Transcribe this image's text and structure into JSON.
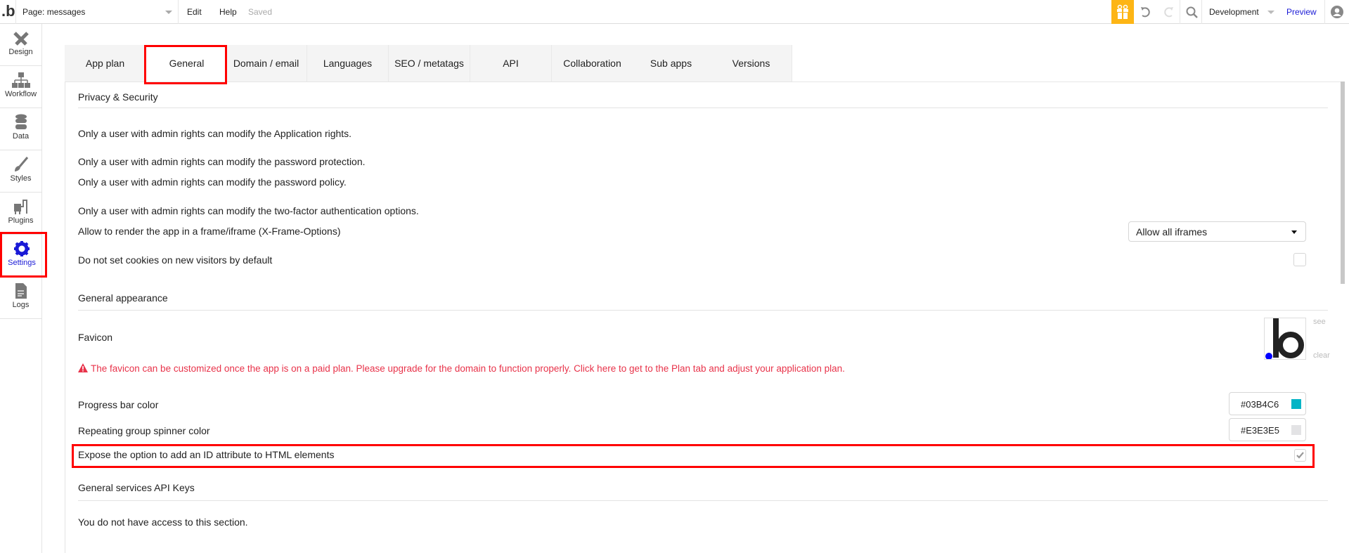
{
  "header": {
    "page_label": "Page: messages",
    "edit": "Edit",
    "help": "Help",
    "status": "Saved",
    "environment": "Development",
    "preview": "Preview"
  },
  "sidebar": {
    "items": [
      {
        "label": "Design"
      },
      {
        "label": "Workflow"
      },
      {
        "label": "Data"
      },
      {
        "label": "Styles"
      },
      {
        "label": "Plugins"
      },
      {
        "label": "Settings"
      },
      {
        "label": "Logs"
      }
    ]
  },
  "tabs": [
    "App plan",
    "General",
    "Domain / email",
    "Languages",
    "SEO / metatags",
    "API",
    "Collaboration",
    "Sub apps",
    "Versions"
  ],
  "privacy": {
    "title": "Privacy & Security",
    "lines": [
      "Only a user with admin rights can modify the Application rights.",
      "Only a user with admin rights can modify the password protection.",
      "Only a user with admin rights can modify the password policy.",
      "Only a user with admin rights can modify the two-factor authentication options."
    ],
    "iframe_label": "Allow to render the app in a frame/iframe (X-Frame-Options)",
    "iframe_value": "Allow all iframes",
    "cookies_label": "Do not set cookies on new visitors by default"
  },
  "appearance": {
    "title": "General appearance",
    "favicon_label": "Favicon",
    "favicon_see": "see",
    "favicon_clear": "clear",
    "warning": "The favicon can be customized once the app is on a paid plan. Please upgrade for the domain to function properly. Click here to get to the Plan tab and adjust your application plan.",
    "progress_label": "Progress bar color",
    "progress_color": "#03B4C6",
    "spinner_label": "Repeating group spinner color",
    "spinner_color": "#E3E3E5",
    "expose_label": "Expose the option to add an ID attribute to HTML elements"
  },
  "api_keys": {
    "title": "General services API Keys",
    "message": "You do not have access to this section."
  },
  "colors": {
    "accent": "#1a1ad6",
    "gift": "#FDB515",
    "warning": "#e8334a",
    "highlight": "#ff0000"
  }
}
